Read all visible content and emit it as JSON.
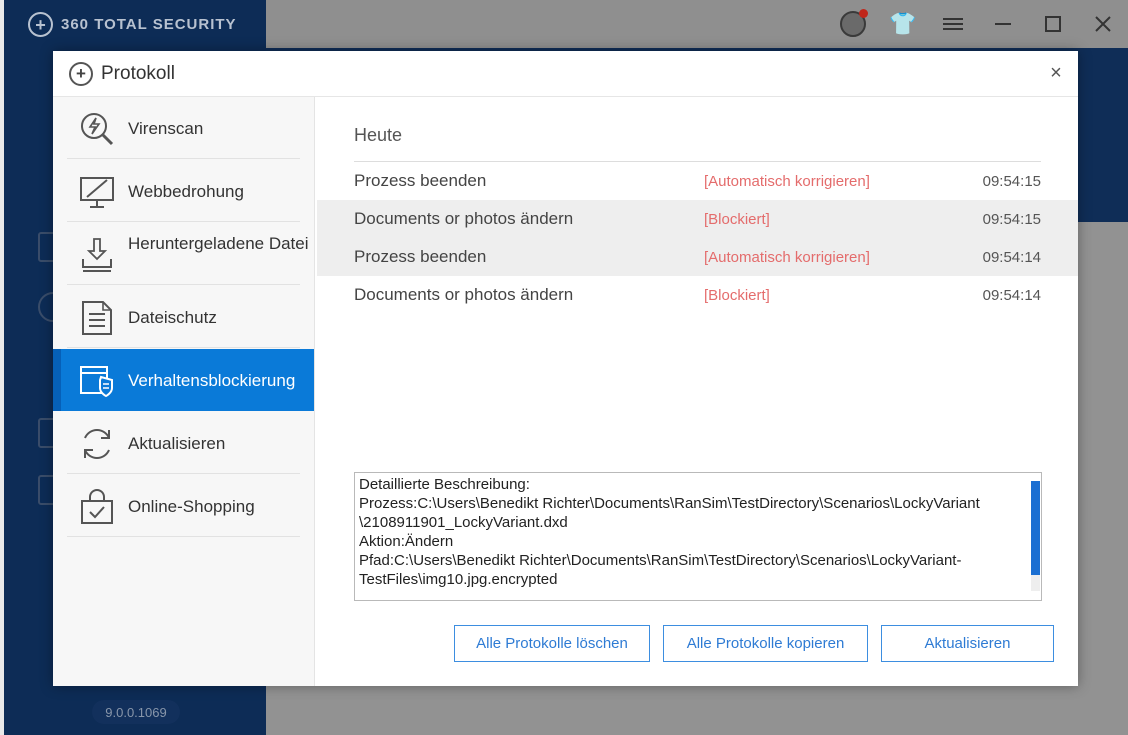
{
  "app": {
    "name": "360 TOTAL SECURITY",
    "version": "9.0.0.1069"
  },
  "dialog": {
    "title": "Protokoll",
    "close_label": "×"
  },
  "sidebar": {
    "items": [
      {
        "label": "Virenscan",
        "icon": "lightning-scan-icon"
      },
      {
        "label": "Webbedrohung",
        "icon": "monitor-slash-icon"
      },
      {
        "label": "Heruntergeladene Datei",
        "icon": "download-tray-icon"
      },
      {
        "label": "Dateischutz",
        "icon": "document-icon"
      },
      {
        "label": "Verhaltensblockierung",
        "icon": "shield-window-icon",
        "active": true
      },
      {
        "label": "Aktualisieren",
        "icon": "refresh-icon"
      },
      {
        "label": "Online-Shopping",
        "icon": "shopping-bag-icon"
      }
    ]
  },
  "main": {
    "section_title": "Heute",
    "rows": [
      {
        "event": "Prozess beenden",
        "action": "[Automatisch korrigieren]",
        "time": "09:54:15"
      },
      {
        "event": "Documents or photos ändern",
        "action": "[Blockiert]",
        "time": "09:54:15"
      },
      {
        "event": "Prozess beenden",
        "action": "[Automatisch korrigieren]",
        "time": "09:54:14"
      },
      {
        "event": "Documents or photos ändern",
        "action": "[Blockiert]",
        "time": "09:54:14"
      }
    ],
    "detail_lines": [
      "Detaillierte Beschreibung:",
      "Prozess:C:\\Users\\Benedikt Richter\\Documents\\RanSim\\TestDirectory\\Scenarios\\LockyVariant",
      "\\2108911901_LockyVariant.dxd",
      "Aktion:Ändern",
      "Pfad:C:\\Users\\Benedikt Richter\\Documents\\RanSim\\TestDirectory\\Scenarios\\LockyVariant-",
      "TestFiles\\img10.jpg.encrypted"
    ],
    "buttons": {
      "delete_all": "Alle Protokolle löschen",
      "copy_all": "Alle Protokolle kopieren",
      "refresh": "Aktualisieren"
    }
  },
  "colors": {
    "accent": "#0a7ad8",
    "warning_text": "#e46c6c",
    "button_border": "#3d8ee0"
  }
}
